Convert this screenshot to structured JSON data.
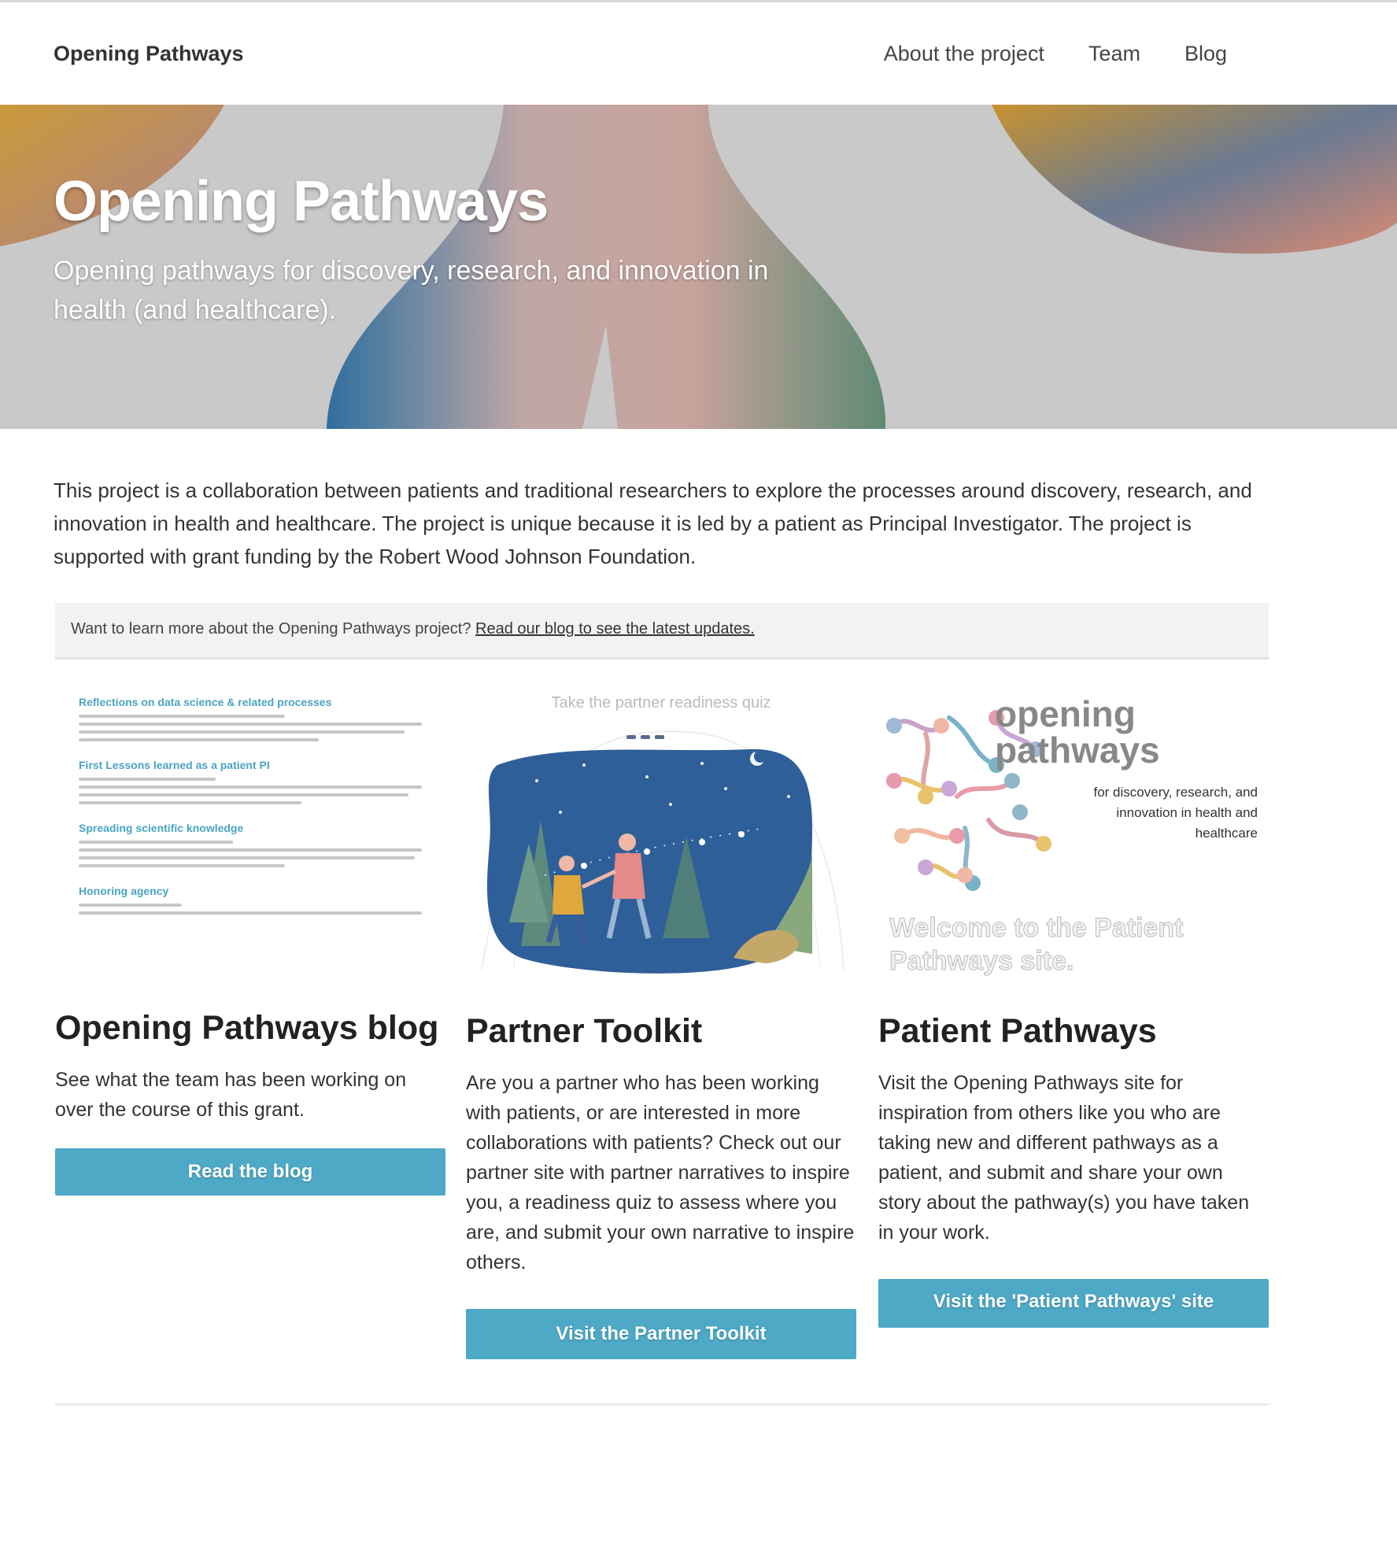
{
  "header": {
    "brand": "Opening Pathways",
    "nav": [
      "About the project",
      "Team",
      "Blog"
    ]
  },
  "hero": {
    "title": "Opening Pathways",
    "subtitle": "Opening pathways for discovery, research, and innovation in health (and healthcare)."
  },
  "intro": "This project is a collaboration between patients and traditional researchers to explore the processes around discovery, research, and innovation in health and healthcare. The project is unique because it is led by a patient as Principal Investigator. The project is supported with grant funding by the Robert Wood Johnson Foundation.",
  "callout": {
    "text": "Want to learn more about the Opening Pathways project?",
    "link": "Read our blog to see the latest updates."
  },
  "cards": [
    {
      "title": "Opening Pathways blog",
      "body": "See what the team has been working on over the course of this grant.",
      "button": "Read the blog",
      "thumb": {
        "posts": [
          "Reflections on data science & related processes",
          "First Lessons learned as a patient PI",
          "Spreading scientific knowledge",
          "Honoring agency"
        ]
      }
    },
    {
      "title": "Partner Toolkit",
      "body": "Are you a partner who has been working with patients, or are interested in more collaborations with patients? Check out our partner site with partner narratives to inspire you, a readiness quiz to assess where you are, and submit your own narrative to inspire others.",
      "button": "Visit the Partner Toolkit",
      "thumb": {
        "heading": "Take the partner readiness quiz"
      }
    },
    {
      "title": "Patient Pathways",
      "body": "Visit the Opening Pathways site for inspiration from others like you who are taking new and different pathways as a patient, and submit and share your own story about the pathway(s) you have taken in your work.",
      "button": "Visit the 'Patient Pathways' site",
      "thumb": {
        "logo_line1": "opening",
        "logo_line2": "pathways",
        "tagline": "for discovery, research, and innovation in health and healthcare",
        "welcome": "Welcome to the Patient Pathways site."
      }
    }
  ],
  "colors": {
    "accent": "#4da9c6",
    "hero_bg": "#c9c9c9",
    "callout_bg": "#f1f2f1"
  }
}
